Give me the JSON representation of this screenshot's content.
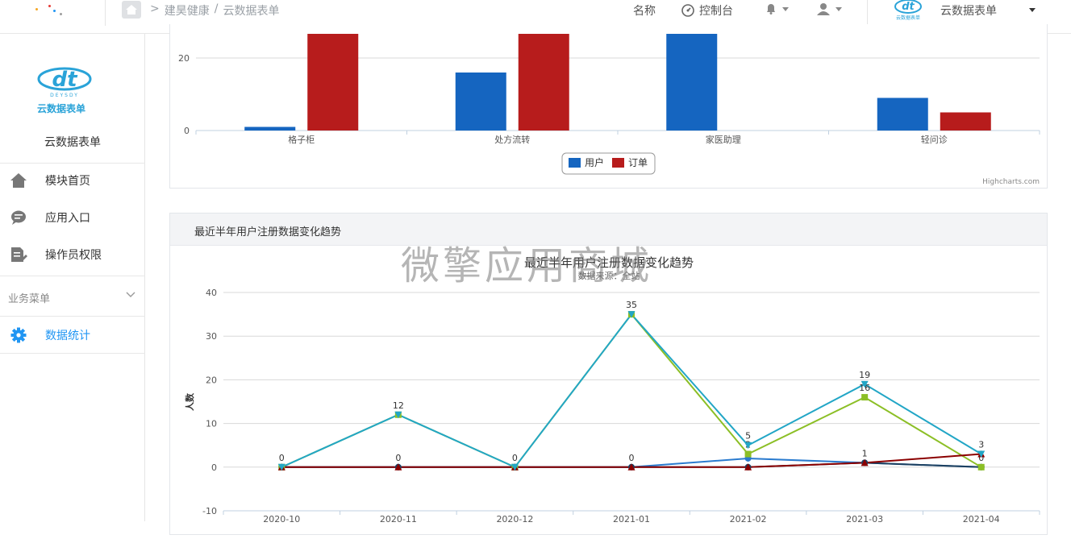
{
  "header": {
    "breadcrumb": [
      "建昊健康",
      "/",
      "云数据表单"
    ],
    "name_label": "名称",
    "console_label": "控制台",
    "app_name": "云数据表单"
  },
  "sidebar": {
    "logo_text": "云数据表单",
    "title": "云数据表单",
    "items": [
      {
        "label": "模块首页",
        "icon": "home-icon"
      },
      {
        "label": "应用入口",
        "icon": "chat-icon"
      },
      {
        "label": "操作员权限",
        "icon": "document-edit-icon"
      }
    ],
    "group_label": "业务菜单",
    "active_item": {
      "label": "数据统计",
      "icon": "gear-icon"
    },
    "active_color": "#2196f3"
  },
  "watermark": "微擎应用商城",
  "bar_panel": {
    "credits": "Highcharts.com"
  },
  "line_panel": {
    "header_title": "最近半年用户注册数据变化趋势"
  },
  "chart_data": [
    {
      "type": "bar",
      "categories": [
        "格子柜",
        "处方流转",
        "家医助理",
        "轻问诊"
      ],
      "series": [
        {
          "name": "用户",
          "color": "#1565c0",
          "values": [
            1,
            16,
            35,
            9
          ]
        },
        {
          "name": "订单",
          "color": "#b71c1c",
          "values": [
            35,
            32,
            0,
            5
          ]
        }
      ],
      "yticks": [
        0,
        20
      ],
      "ylim": [
        0,
        20
      ],
      "legend": "bottom-center"
    },
    {
      "type": "line",
      "title": "最近半年用户注册数据变化趋势",
      "subtitle": "数据来源：全站",
      "ylabel": "人数",
      "categories": [
        "2020-10",
        "2020-11",
        "2020-12",
        "2021-01",
        "2021-02",
        "2021-03",
        "2021-04"
      ],
      "ylim": [
        -10,
        40
      ],
      "yticks": [
        -10,
        0,
        10,
        20,
        30,
        40
      ],
      "grid": true,
      "series": [
        {
          "color": "#2a7bcf",
          "marker": "circle",
          "values": [
            0,
            0,
            0,
            0,
            2,
            1,
            0
          ],
          "labels": [
            "",
            "",
            "",
            "",
            "",
            "",
            ""
          ]
        },
        {
          "color": "#1c3f5e",
          "marker": "circle",
          "values": [
            0,
            0,
            0,
            0,
            0,
            1,
            0
          ],
          "labels": [
            "",
            "",
            "",
            "",
            "",
            "1",
            "0"
          ]
        },
        {
          "color": "#8cbf26",
          "marker": "square",
          "values": [
            0,
            12,
            0,
            35,
            3,
            16,
            0
          ],
          "labels": [
            "",
            "",
            "",
            "",
            "2",
            "16",
            ""
          ]
        },
        {
          "color": "#8b0000",
          "marker": "triangle",
          "values": [
            0,
            0,
            0,
            0,
            0,
            1,
            3
          ],
          "labels": [
            "",
            "0",
            "",
            "0",
            "",
            "",
            "3"
          ]
        },
        {
          "color": "#22a6c6",
          "marker": "triangle-down",
          "values": [
            0,
            12,
            0,
            35,
            5,
            19,
            3
          ],
          "labels": [
            "0",
            "12",
            "0",
            "35",
            "5",
            "19",
            ""
          ]
        }
      ]
    }
  ]
}
